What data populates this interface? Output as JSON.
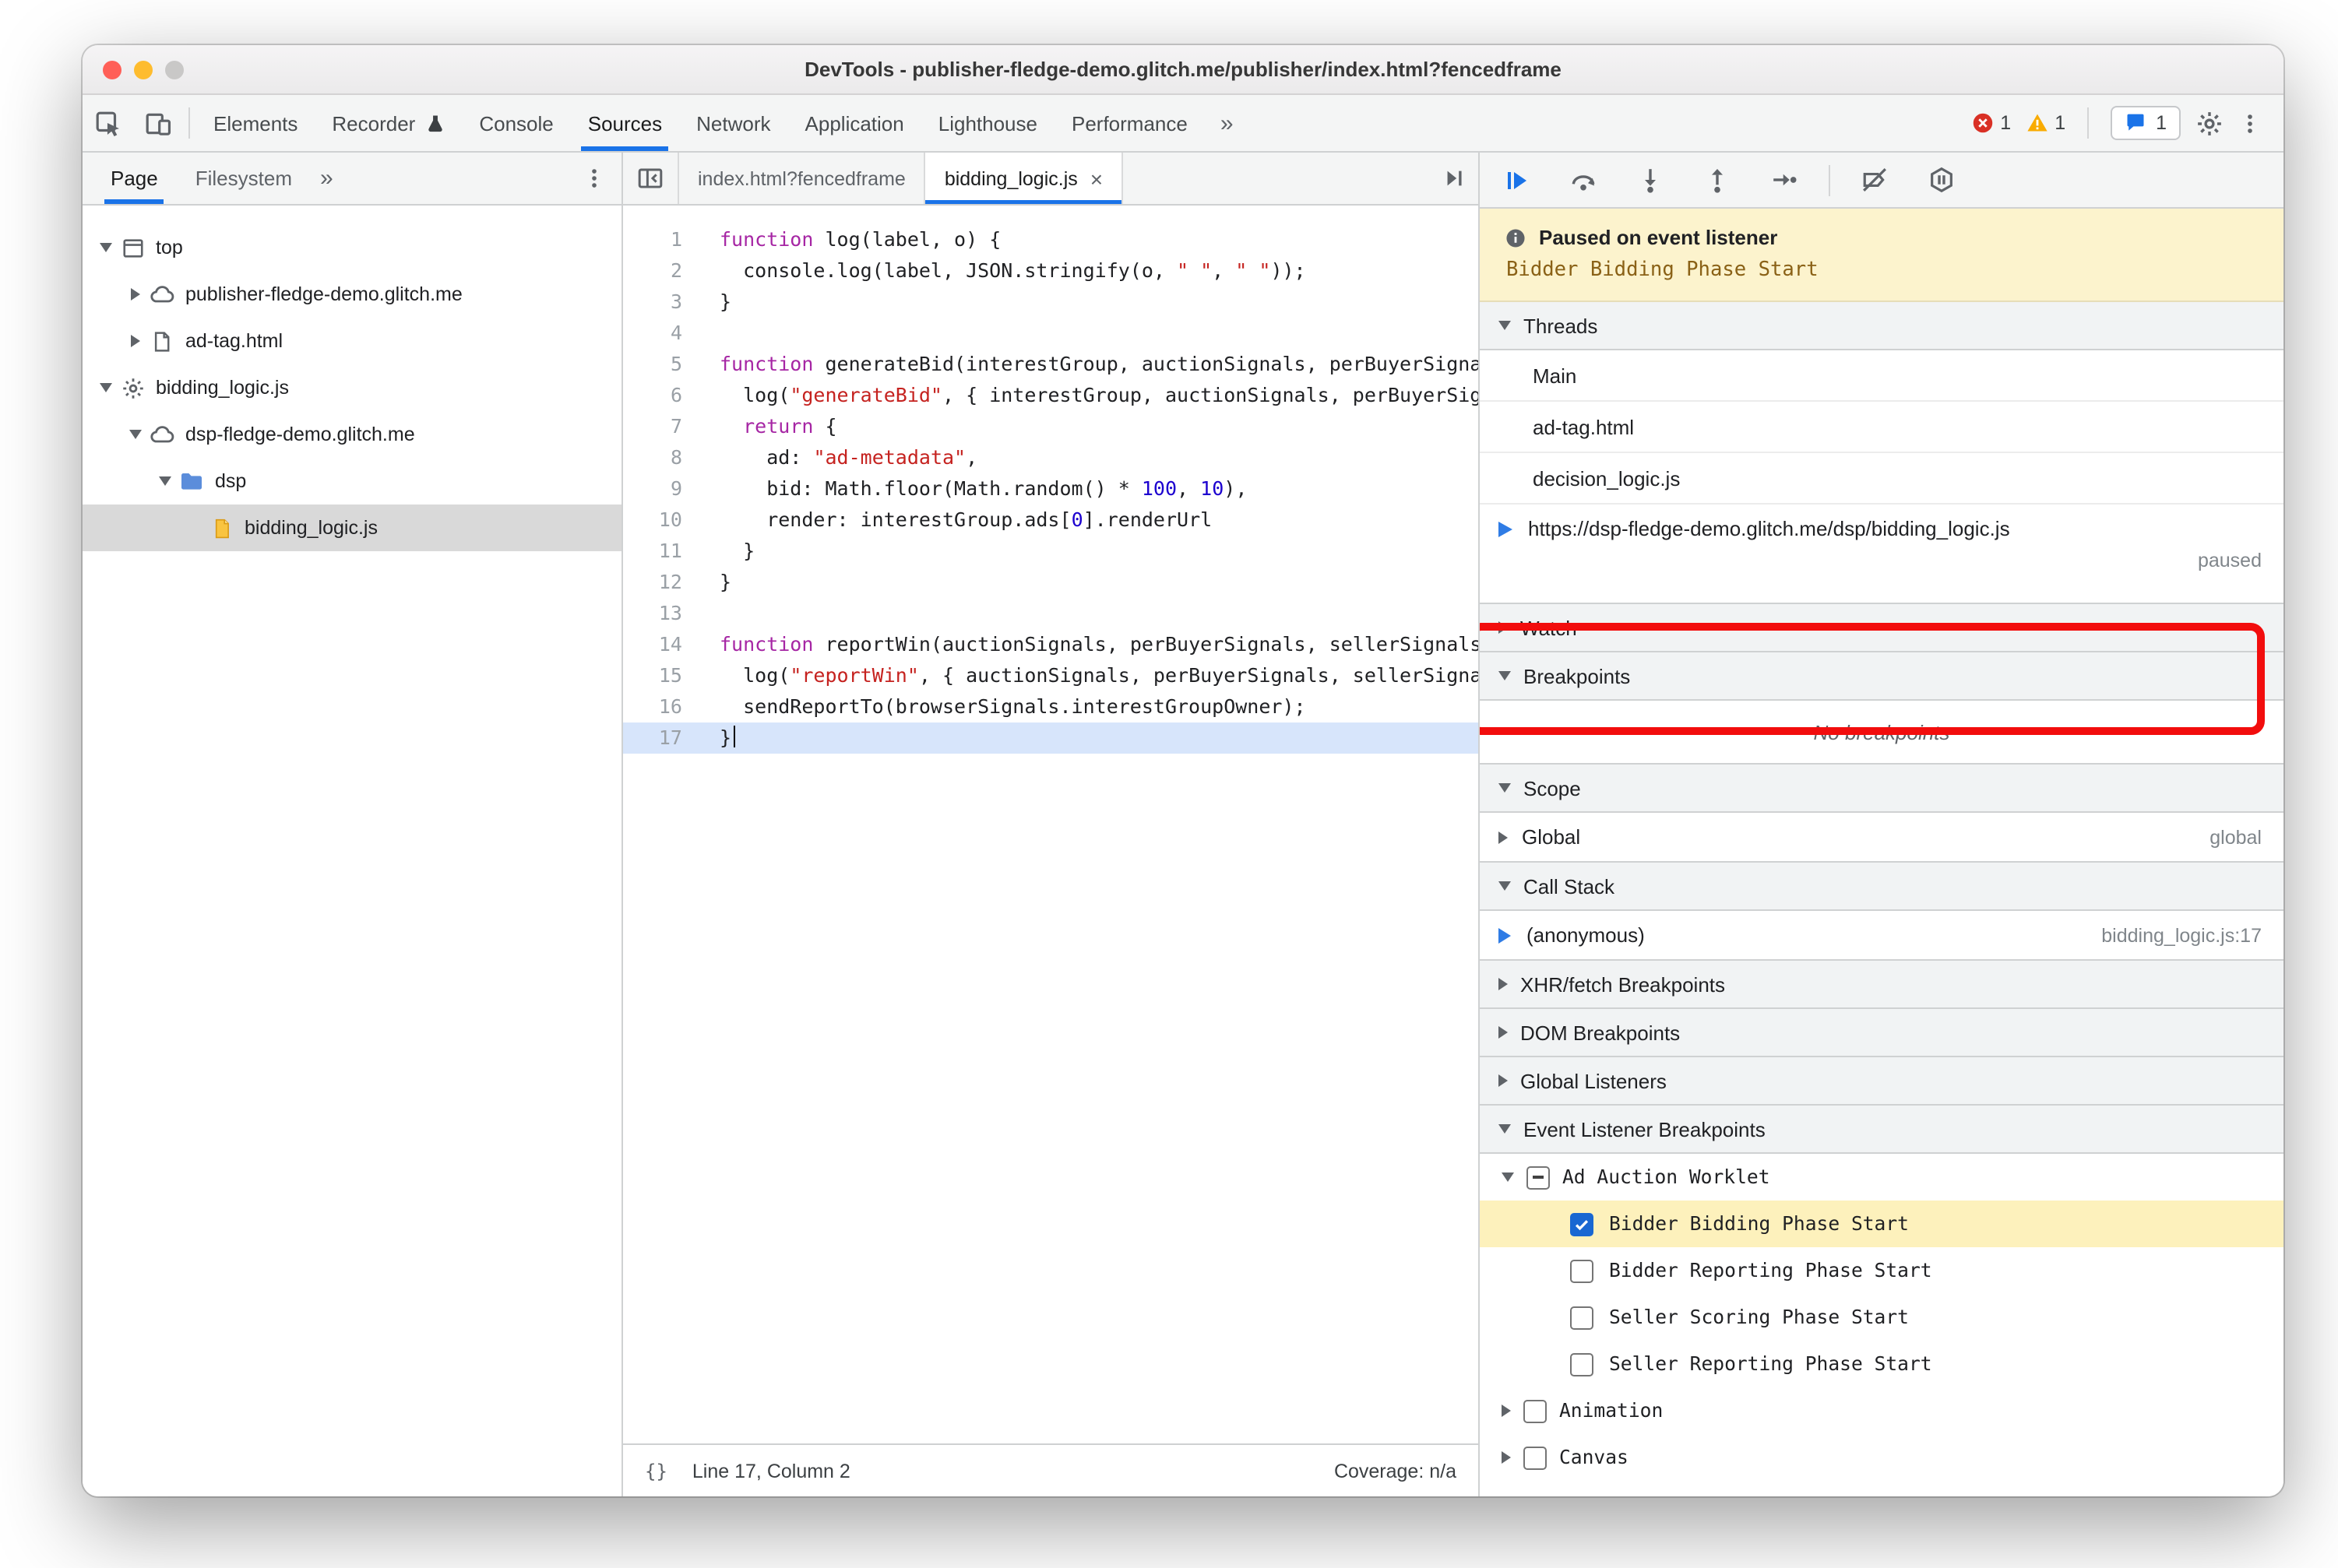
{
  "window": {
    "title": "DevTools - publisher-fledge-demo.glitch.me/publisher/index.html?fencedframe"
  },
  "colors": {
    "accent": "#1a73e8",
    "annotation": "#f20d0d",
    "paused_banner_bg": "#fcf3cd",
    "event_highlight_bg": "#fdf1bc"
  },
  "toolbar": {
    "tabs": [
      {
        "label": "Elements"
      },
      {
        "label": "Recorder",
        "badge": "flask"
      },
      {
        "label": "Console"
      },
      {
        "label": "Sources",
        "selected": true
      },
      {
        "label": "Network"
      },
      {
        "label": "Application"
      },
      {
        "label": "Lighthouse"
      },
      {
        "label": "Performance"
      }
    ],
    "overflow": "»",
    "error_count": "1",
    "warning_count": "1",
    "issues_count": "1"
  },
  "navigator": {
    "tabs": [
      "Page",
      "Filesystem"
    ],
    "overflow": "»",
    "tree": [
      {
        "label": "top",
        "icon": "frame",
        "level": 0,
        "disclosure": "down"
      },
      {
        "label": "publisher-fledge-demo.glitch.me",
        "icon": "cloud",
        "level": 1,
        "disclosure": "right"
      },
      {
        "label": "ad-tag.html",
        "icon": "document",
        "level": 1,
        "disclosure": "right"
      },
      {
        "label": "bidding_logic.js",
        "icon": "gear",
        "level": 0,
        "disclosure": "down"
      },
      {
        "label": "dsp-fledge-demo.glitch.me",
        "icon": "cloud",
        "level": 1,
        "disclosure": "down"
      },
      {
        "label": "dsp",
        "icon": "folder",
        "level": 2,
        "disclosure": "down"
      },
      {
        "label": "bidding_logic.js",
        "icon": "file",
        "level": 3,
        "disclosure": "none",
        "selected": true
      }
    ]
  },
  "editor": {
    "tabs": [
      {
        "label": "index.html?fencedframe"
      },
      {
        "label": "bidding_logic.js",
        "active": true
      }
    ],
    "close_glyph": "×",
    "current_line": 17,
    "lines": [
      [
        [
          "kw",
          "function"
        ],
        [
          "pl",
          " log(label, o) {"
        ]
      ],
      [
        [
          "pl",
          "  console.log(label, JSON.stringify(o, "
        ],
        [
          "str",
          "\" \""
        ],
        [
          "pl",
          ", "
        ],
        [
          "str",
          "\" \""
        ],
        [
          "pl",
          "));"
        ]
      ],
      [
        [
          "pl",
          "}"
        ]
      ],
      [],
      [
        [
          "kw",
          "function"
        ],
        [
          "pl",
          " generateBid(interestGroup, auctionSignals, perBuyerSignals, trustedBiddingSignals, browserSignals) {"
        ]
      ],
      [
        [
          "pl",
          "  log("
        ],
        [
          "str",
          "\"generateBid\""
        ],
        [
          "pl",
          ", { interestGroup, auctionSignals, perBuyerSignals, trustedBiddingSignals, browserSignals });"
        ]
      ],
      [
        [
          "pl",
          "  "
        ],
        [
          "kw",
          "return"
        ],
        [
          "pl",
          " {"
        ]
      ],
      [
        [
          "pl",
          "    ad: "
        ],
        [
          "str",
          "\"ad-metadata\""
        ],
        [
          "pl",
          ","
        ]
      ],
      [
        [
          "pl",
          "    bid: Math.floor(Math.random() * "
        ],
        [
          "num",
          "100"
        ],
        [
          "pl",
          ", "
        ],
        [
          "num",
          "10"
        ],
        [
          "pl",
          "),"
        ]
      ],
      [
        [
          "pl",
          "    render: interestGroup.ads["
        ],
        [
          "num",
          "0"
        ],
        [
          "pl",
          "].renderUrl"
        ]
      ],
      [
        [
          "pl",
          "  }"
        ]
      ],
      [
        [
          "pl",
          "}"
        ]
      ],
      [],
      [
        [
          "kw",
          "function"
        ],
        [
          "pl",
          " reportWin(auctionSignals, perBuyerSignals, sellerSignals, browserSignals) {"
        ]
      ],
      [
        [
          "pl",
          "  log("
        ],
        [
          "str",
          "\"reportWin\""
        ],
        [
          "pl",
          ", { auctionSignals, perBuyerSignals, sellerSignals, browserSignals });"
        ]
      ],
      [
        [
          "pl",
          "  sendReportTo(browserSignals.interestGroupOwner);"
        ]
      ],
      [
        [
          "pl",
          "}"
        ]
      ]
    ],
    "status": {
      "pretty": "{}",
      "line_col": "Line 17, Column 2",
      "coverage": "Coverage: n/a"
    }
  },
  "debugger": {
    "toolbar_icons": [
      "resume",
      "step-over",
      "step-into",
      "step-out",
      "step",
      "|",
      "deactivate-breakpoints",
      "pause-on-exceptions"
    ],
    "banner": {
      "title": "Paused on event listener",
      "reason": "Bidder Bidding Phase Start"
    },
    "sections": {
      "threads": "Threads",
      "watch": "Watch",
      "breakpoints": "Breakpoints",
      "scope": "Scope",
      "call_stack": "Call Stack",
      "xhr": "XHR/fetch Breakpoints",
      "dom": "DOM Breakpoints",
      "global_listeners": "Global Listeners",
      "elb": "Event Listener Breakpoints"
    },
    "threads_items": [
      "Main",
      "ad-tag.html",
      "decision_logic.js"
    ],
    "active_thread": {
      "url": "https://dsp-fledge-demo.glitch.me/dsp/bidding_logic.js",
      "status": "paused"
    },
    "breakpoints_empty": "No breakpoints",
    "scope_rows": [
      {
        "label": "Global",
        "value": "global"
      }
    ],
    "call_stack_frames": [
      {
        "label": "(anonymous)",
        "location": "bidding_logic.js:17"
      }
    ],
    "elb_categories": [
      {
        "label": "Ad Auction Worklet",
        "state": "indeterminate",
        "expanded": true,
        "events": [
          {
            "label": "Bidder Bidding Phase Start",
            "checked": true,
            "highlighted": true
          },
          {
            "label": "Bidder Reporting Phase Start",
            "checked": false
          },
          {
            "label": "Seller Scoring Phase Start",
            "checked": false
          },
          {
            "label": "Seller Reporting Phase Start",
            "checked": false
          }
        ]
      },
      {
        "label": "Animation",
        "state": "unchecked",
        "expanded": false,
        "events": []
      },
      {
        "label": "Canvas",
        "state": "unchecked",
        "expanded": false,
        "events": []
      }
    ]
  }
}
